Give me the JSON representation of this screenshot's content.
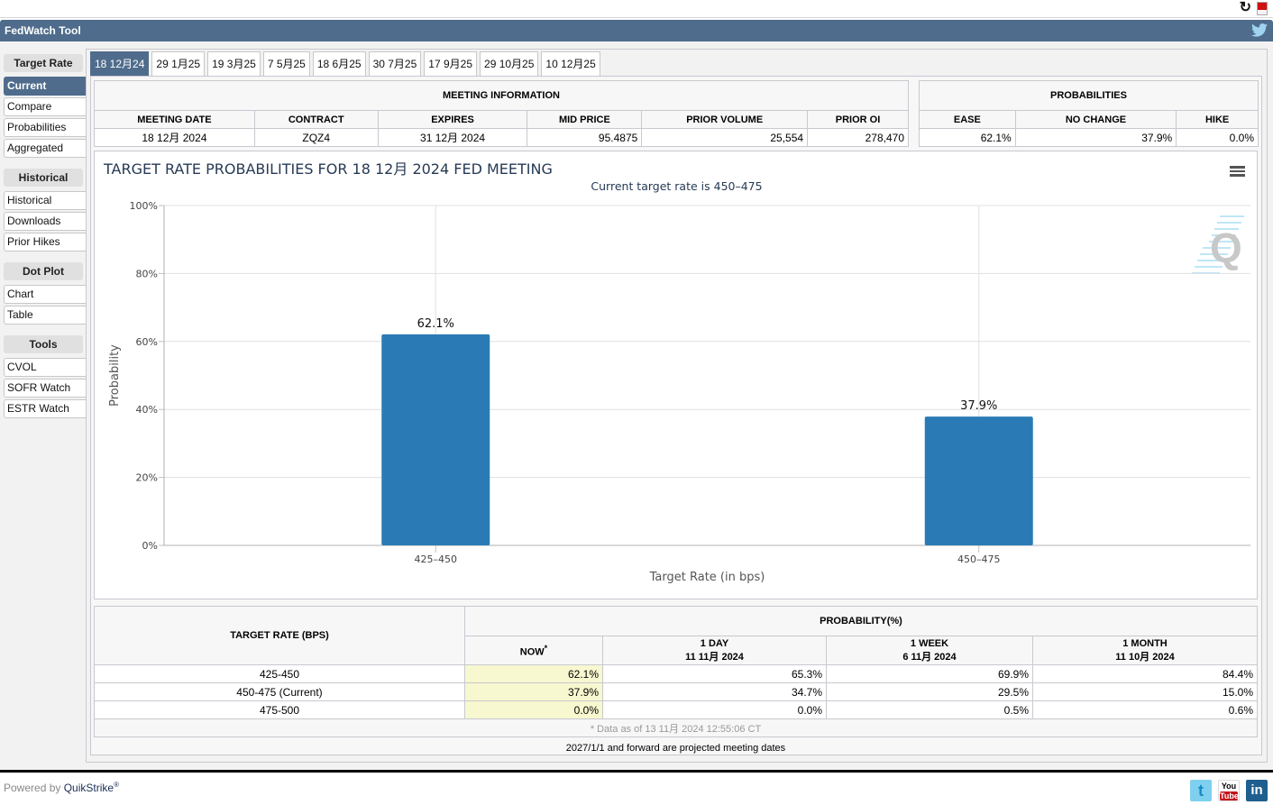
{
  "app": {
    "title": "FedWatch Tool"
  },
  "browser": {
    "reload_icon": "reload-icon",
    "pdf_icon": "pdf-icon"
  },
  "sidebar": {
    "sections": [
      {
        "heading": "Target Rate",
        "items": [
          {
            "label": "Current",
            "active": true
          },
          {
            "label": "Compare",
            "active": false
          },
          {
            "label": "Probabilities",
            "active": false
          },
          {
            "label": "Aggregated",
            "active": false
          }
        ]
      },
      {
        "heading": "Historical",
        "items": [
          {
            "label": "Historical",
            "active": false
          },
          {
            "label": "Downloads",
            "active": false
          },
          {
            "label": "Prior Hikes",
            "active": false
          }
        ]
      },
      {
        "heading": "Dot Plot",
        "items": [
          {
            "label": "Chart",
            "active": false
          },
          {
            "label": "Table",
            "active": false
          }
        ]
      },
      {
        "heading": "Tools",
        "items": [
          {
            "label": "CVOL",
            "active": false
          },
          {
            "label": "SOFR Watch",
            "active": false
          },
          {
            "label": "ESTR Watch",
            "active": false
          }
        ]
      }
    ]
  },
  "tabs": [
    {
      "label": "18 12月24",
      "active": true
    },
    {
      "label": "29 1月25",
      "active": false
    },
    {
      "label": "19 3月25",
      "active": false
    },
    {
      "label": "7 5月25",
      "active": false
    },
    {
      "label": "18 6月25",
      "active": false
    },
    {
      "label": "30 7月25",
      "active": false
    },
    {
      "label": "17 9月25",
      "active": false
    },
    {
      "label": "29 10月25",
      "active": false
    },
    {
      "label": "10 12月25",
      "active": false
    }
  ],
  "meeting_info": {
    "title": "MEETING INFORMATION",
    "headers": [
      "MEETING DATE",
      "CONTRACT",
      "EXPIRES",
      "MID PRICE",
      "PRIOR VOLUME",
      "PRIOR OI"
    ],
    "values": [
      "18 12月 2024",
      "ZQZ4",
      "31 12月 2024",
      "95.4875",
      "25,554",
      "278,470"
    ]
  },
  "probabilities": {
    "title": "PROBABILITIES",
    "headers": [
      "EASE",
      "NO CHANGE",
      "HIKE"
    ],
    "values": [
      "62.1%",
      "37.9%",
      "0.0%"
    ]
  },
  "chart_data": {
    "type": "bar",
    "title": "TARGET RATE PROBABILITIES FOR 18 12月 2024 FED MEETING",
    "subtitle": "Current target rate is 450–475",
    "xlabel": "Target Rate (in bps)",
    "ylabel": "Probability",
    "categories": [
      "425–450",
      "450–475"
    ],
    "values": [
      62.1,
      37.9
    ],
    "data_labels": [
      "62.1%",
      "37.9%"
    ],
    "ylim": [
      0,
      100
    ],
    "yticks": [
      0,
      20,
      40,
      60,
      80,
      100
    ],
    "ytick_labels": [
      "0%",
      "20%",
      "40%",
      "60%",
      "80%",
      "100%"
    ],
    "grid": true,
    "bar_color": "#2a7bb5",
    "legend": "none"
  },
  "history_table": {
    "rate_header": "TARGET RATE (BPS)",
    "prob_header": "PROBABILITY(%)",
    "columns": [
      {
        "label": "NOW",
        "sup": "*",
        "date": ""
      },
      {
        "label": "1 DAY",
        "date": "11 11月 2024"
      },
      {
        "label": "1 WEEK",
        "date": "6 11月 2024"
      },
      {
        "label": "1 MONTH",
        "date": "11 10月 2024"
      }
    ],
    "rows": [
      {
        "rate": "425-450",
        "values": [
          "62.1%",
          "65.3%",
          "69.9%",
          "84.4%"
        ]
      },
      {
        "rate": "450-475 (Current)",
        "values": [
          "37.9%",
          "34.7%",
          "29.5%",
          "15.0%"
        ]
      },
      {
        "rate": "475-500",
        "values": [
          "0.0%",
          "0.0%",
          "0.5%",
          "0.6%"
        ]
      }
    ],
    "note": "* Data as of 13 11月 2024 12:55:06 CT"
  },
  "projected_note": "2027/1/1 and forward are projected meeting dates",
  "footer": {
    "powered_by": "Powered by",
    "brand": "QuikStrike",
    "reg": "®",
    "social": [
      "twitter",
      "youtube",
      "linkedin"
    ],
    "youtube_top": "You",
    "youtube_bottom": "Tube",
    "linkedin_text": "in",
    "twitter_text": "t"
  }
}
